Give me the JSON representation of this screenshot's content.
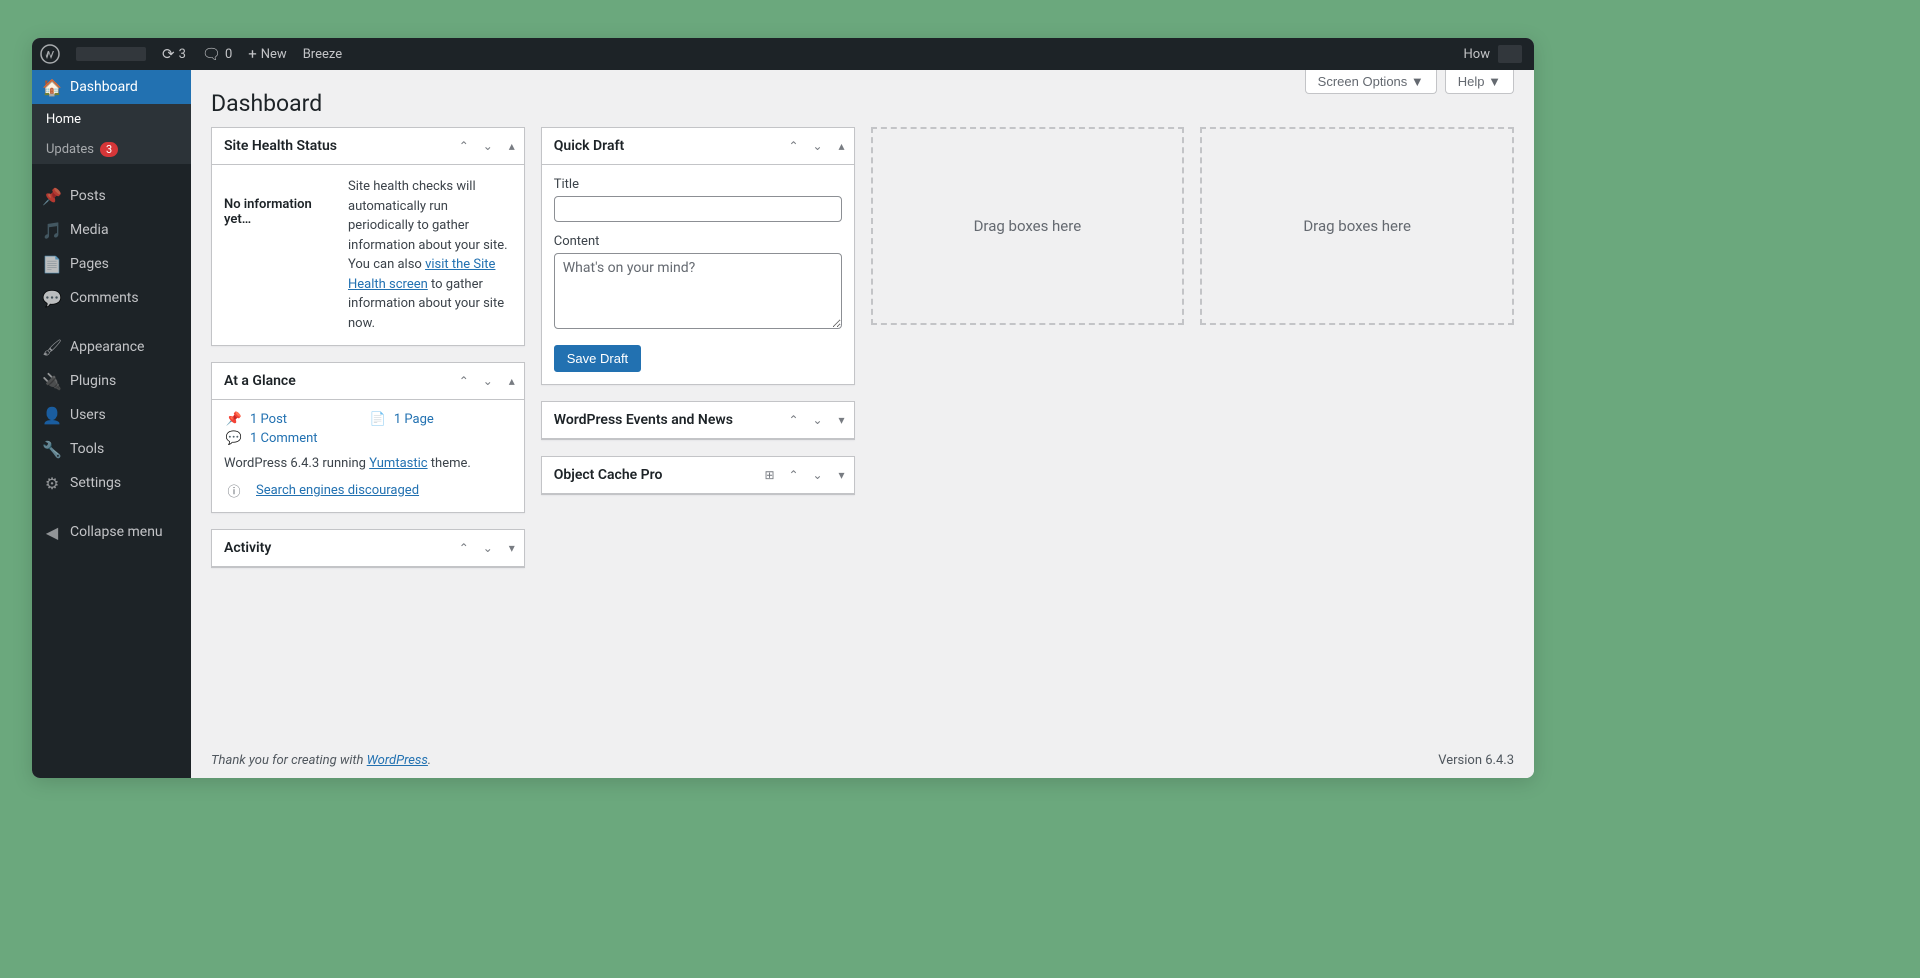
{
  "toolbar": {
    "updates_count": "3",
    "comments_count": "0",
    "new_label": "New",
    "breeze_label": "Breeze",
    "greeting": "How"
  },
  "sidebar": {
    "items": [
      {
        "label": "Dashboard"
      },
      {
        "label": "Home"
      },
      {
        "label": "Updates",
        "badge": "3"
      },
      {
        "label": "Posts"
      },
      {
        "label": "Media"
      },
      {
        "label": "Pages"
      },
      {
        "label": "Comments"
      },
      {
        "label": "Appearance"
      },
      {
        "label": "Plugins"
      },
      {
        "label": "Users"
      },
      {
        "label": "Tools"
      },
      {
        "label": "Settings"
      },
      {
        "label": "Collapse menu"
      }
    ]
  },
  "screen_meta": {
    "screen_options": "Screen Options",
    "help": "Help"
  },
  "page": {
    "title": "Dashboard"
  },
  "widgets": {
    "site_health": {
      "title": "Site Health Status",
      "status": "No information yet…",
      "text_a": "Site health checks will automatically run periodically to gather information about your site. You can also ",
      "link_text": "visit the Site Health screen",
      "text_b": " to gather information about your site now."
    },
    "at_a_glance": {
      "title": "At a Glance",
      "posts": "1 Post",
      "pages": "1 Page",
      "comments": "1 Comment",
      "version_pre": "WordPress 6.4.3 running ",
      "theme": "Yumtastic",
      "version_post": " theme.",
      "search_engines": "Search engines discouraged"
    },
    "activity": {
      "title": "Activity"
    },
    "quick_draft": {
      "title": "Quick Draft",
      "title_label": "Title",
      "content_label": "Content",
      "content_placeholder": "What's on your mind?",
      "save": "Save Draft"
    },
    "events": {
      "title": "WordPress Events and News"
    },
    "ocp": {
      "title": "Object Cache Pro"
    },
    "drag_placeholder": "Drag boxes here"
  },
  "footer": {
    "text_pre": "Thank you for creating with ",
    "link": "WordPress",
    "version": "Version 6.4.3"
  }
}
